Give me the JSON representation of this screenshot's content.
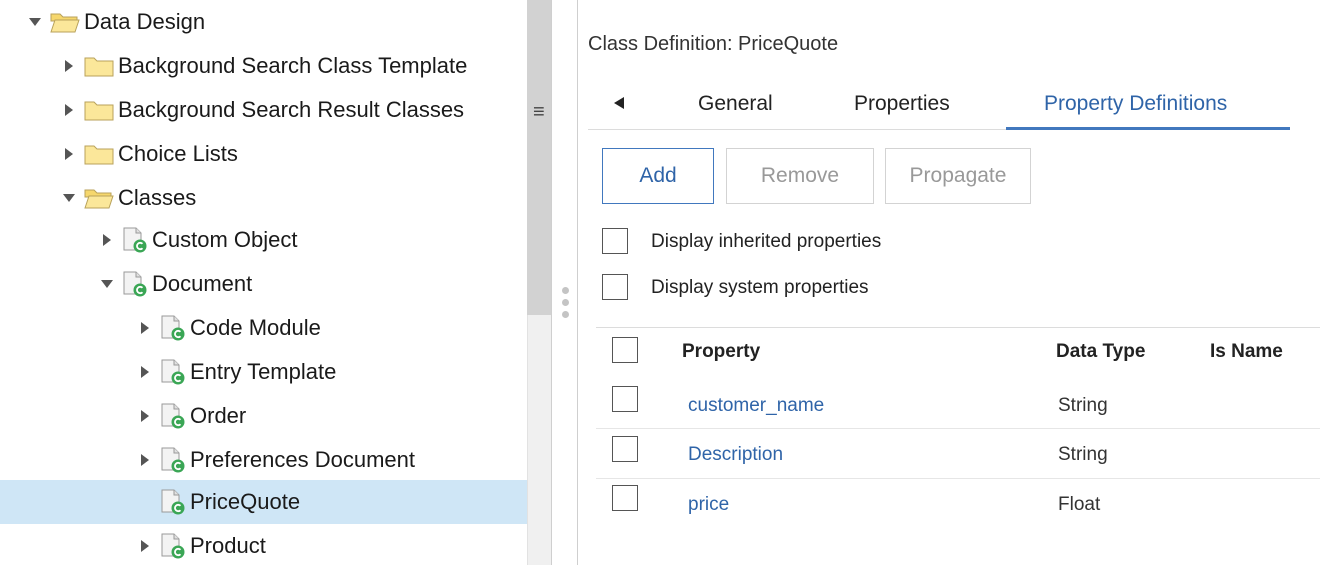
{
  "tree": {
    "items": [
      {
        "label": "Data Design",
        "expanded": true,
        "icon": "folder-open-icon"
      },
      {
        "label": "Background Search Class Template",
        "expanded": false,
        "icon": "folder-icon"
      },
      {
        "label": "Background Search Result Classes",
        "expanded": false,
        "icon": "folder-icon"
      },
      {
        "label": "Choice Lists",
        "expanded": false,
        "icon": "folder-icon"
      },
      {
        "label": "Classes",
        "expanded": true,
        "icon": "folder-open-icon"
      },
      {
        "label": "Custom Object",
        "expanded": false,
        "icon": "class-icon"
      },
      {
        "label": "Document",
        "expanded": true,
        "icon": "class-icon"
      },
      {
        "label": "Code Module",
        "expanded": false,
        "icon": "class-icon"
      },
      {
        "label": "Entry Template",
        "expanded": false,
        "icon": "class-icon"
      },
      {
        "label": "Order",
        "expanded": false,
        "icon": "class-icon"
      },
      {
        "label": "Preferences Document",
        "expanded": false,
        "icon": "class-icon"
      },
      {
        "label": "PriceQuote",
        "expanded": false,
        "icon": "class-icon",
        "selected": true
      },
      {
        "label": "Product",
        "expanded": false,
        "icon": "class-icon"
      }
    ],
    "menu_glyph": "≡"
  },
  "detail": {
    "title": "Class Definition: PriceQuote",
    "tabs": [
      {
        "label": "General"
      },
      {
        "label": "Properties"
      },
      {
        "label": "Property Definitions",
        "active": true
      }
    ],
    "buttons": {
      "add": "Add",
      "remove": "Remove",
      "propagate": "Propagate"
    },
    "options": {
      "inherited": "Display inherited properties",
      "system": "Display system properties"
    },
    "grid": {
      "columns": [
        "Property",
        "Data Type",
        "Is Name"
      ],
      "rows": [
        {
          "property": "customer_name",
          "data_type": "String"
        },
        {
          "property": "Description",
          "data_type": "String"
        },
        {
          "property": "price",
          "data_type": "Float"
        }
      ]
    }
  },
  "colors": {
    "accent": "#4178be",
    "selected_row": "#cfe6f6",
    "folder": "#fbe79a"
  }
}
